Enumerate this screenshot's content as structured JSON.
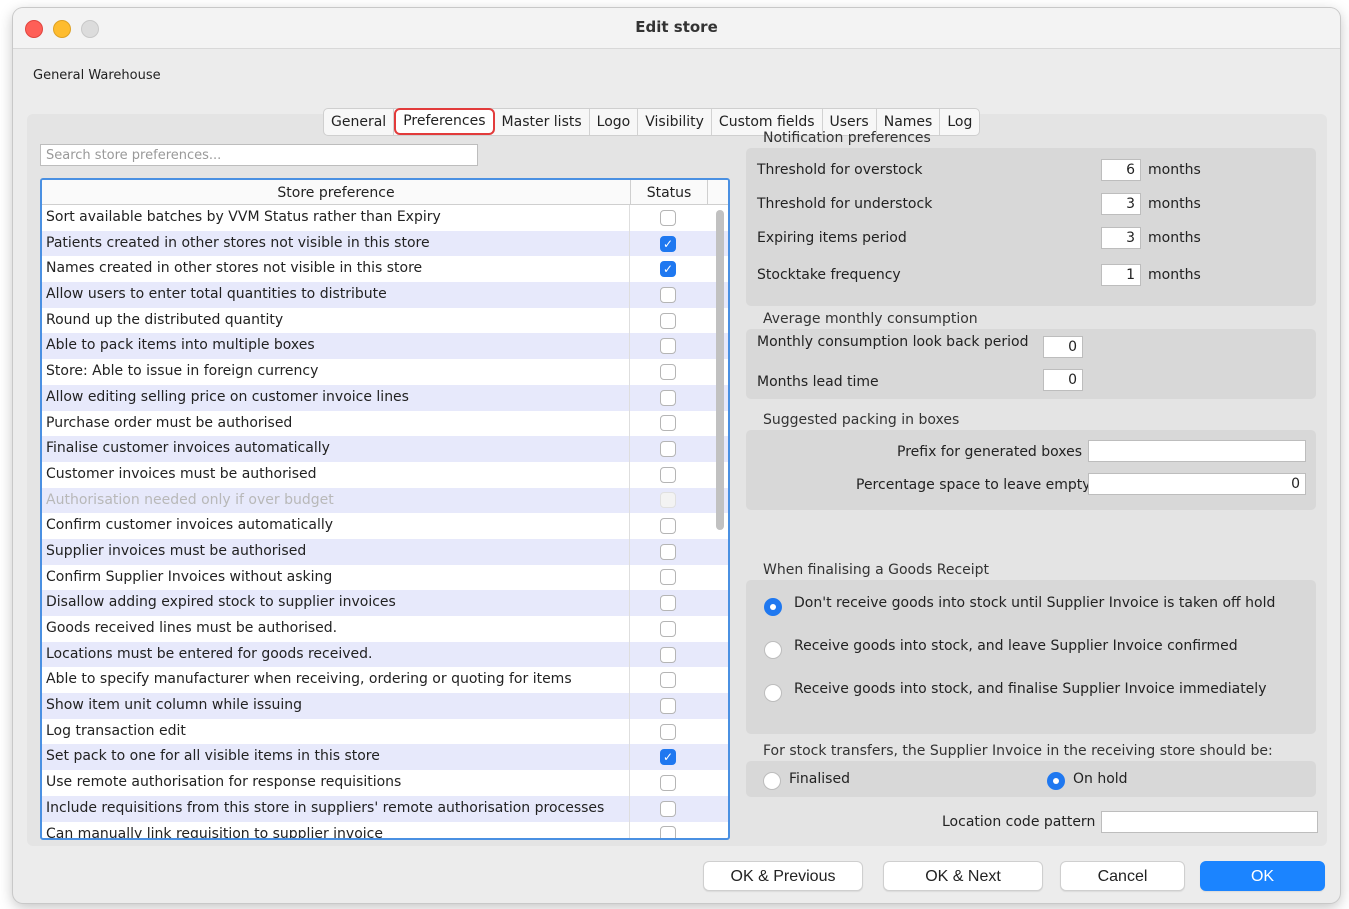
{
  "window": {
    "title": "Edit store"
  },
  "store_name": "General Warehouse",
  "tabs": [
    {
      "label": "General"
    },
    {
      "label": "Preferences",
      "active": true
    },
    {
      "label": "Master lists"
    },
    {
      "label": "Logo"
    },
    {
      "label": "Visibility"
    },
    {
      "label": "Custom fields"
    },
    {
      "label": "Users"
    },
    {
      "label": "Names"
    },
    {
      "label": "Log"
    }
  ],
  "search": {
    "placeholder": "Search store preferences..."
  },
  "table": {
    "col_preference": "Store preference",
    "col_status": "Status",
    "rows": [
      {
        "label": "Sort available batches by VVM Status rather than Expiry",
        "checked": false
      },
      {
        "label": "Patients created in other stores not visible in this store",
        "checked": true
      },
      {
        "label": "Names created in other stores not visible in this store",
        "checked": true
      },
      {
        "label": "Allow users to enter total quantities to distribute",
        "checked": false
      },
      {
        "label": "Round up the distributed quantity",
        "checked": false
      },
      {
        "label": "Able to pack items into multiple boxes",
        "checked": false
      },
      {
        "label": "Store: Able to issue in foreign currency",
        "checked": false
      },
      {
        "label": "Allow editing selling price on customer invoice lines",
        "checked": false
      },
      {
        "label": "Purchase order must be authorised",
        "checked": false
      },
      {
        "label": "Finalise customer invoices automatically",
        "checked": false
      },
      {
        "label": "Customer invoices must be authorised",
        "checked": false
      },
      {
        "label": "Authorisation needed only if over budget",
        "checked": false,
        "disabled": true
      },
      {
        "label": "Confirm customer invoices automatically",
        "checked": false
      },
      {
        "label": "Supplier invoices must be authorised",
        "checked": false
      },
      {
        "label": "Confirm Supplier Invoices without asking",
        "checked": false
      },
      {
        "label": "Disallow adding expired stock to supplier invoices",
        "checked": false
      },
      {
        "label": "Goods received lines must be authorised.",
        "checked": false
      },
      {
        "label": "Locations must be entered for goods received.",
        "checked": false
      },
      {
        "label": "Able to specify manufacturer when receiving, ordering or quoting for items",
        "checked": false
      },
      {
        "label": "Show item unit column while issuing",
        "checked": false
      },
      {
        "label": "Log transaction edit",
        "checked": false
      },
      {
        "label": "Set pack to one for all visible items in this store",
        "checked": true
      },
      {
        "label": "Use remote authorisation for response requisitions",
        "checked": false
      },
      {
        "label": "Include requisitions from this store in suppliers' remote authorisation processes",
        "checked": false
      },
      {
        "label": "Can manually link requisition to supplier invoice",
        "checked": false
      }
    ]
  },
  "notification": {
    "title": "Notification preferences",
    "overstock_label": "Threshold for overstock",
    "overstock_value": "6",
    "overstock_unit": "months",
    "understock_label": "Threshold for understock",
    "understock_value": "3",
    "understock_unit": "months",
    "expiring_label": "Expiring items period",
    "expiring_value": "3",
    "expiring_unit": "months",
    "stocktake_label": "Stocktake frequency",
    "stocktake_value": "1",
    "stocktake_unit": "months"
  },
  "amc": {
    "title": "Average monthly consumption",
    "lookback_label": "Monthly consumption look back period",
    "lookback_value": "0",
    "lead_label": "Months lead time",
    "lead_value": "0"
  },
  "packing": {
    "title": "Suggested packing in boxes",
    "prefix_label": "Prefix for generated boxes",
    "prefix_value": "",
    "empty_label": "Percentage space to leave empty",
    "empty_value": "0"
  },
  "goods_receipt": {
    "title": "When finalising a Goods Receipt",
    "options": [
      {
        "label": "Don't receive goods into stock until Supplier Invoice is taken off hold",
        "selected": true
      },
      {
        "label": "Receive goods into stock, and leave Supplier Invoice confirmed",
        "selected": false
      },
      {
        "label": "Receive goods into stock, and finalise Supplier Invoice immediately",
        "selected": false
      }
    ]
  },
  "transfers": {
    "title": "For stock transfers, the Supplier Invoice in the receiving store should be:",
    "finalised_label": "Finalised",
    "finalised_selected": false,
    "onhold_label": "On hold",
    "onhold_selected": true
  },
  "location": {
    "label": "Location code pattern",
    "value": ""
  },
  "buttons": {
    "ok_previous": "OK & Previous",
    "ok_next": "OK & Next",
    "cancel": "Cancel",
    "ok": "OK"
  },
  "colors": {
    "accent": "#1f78f0",
    "primary_button": "#1b84ff",
    "tab_highlight": "#e23b3b",
    "row_alt": "#e7e9fb"
  }
}
